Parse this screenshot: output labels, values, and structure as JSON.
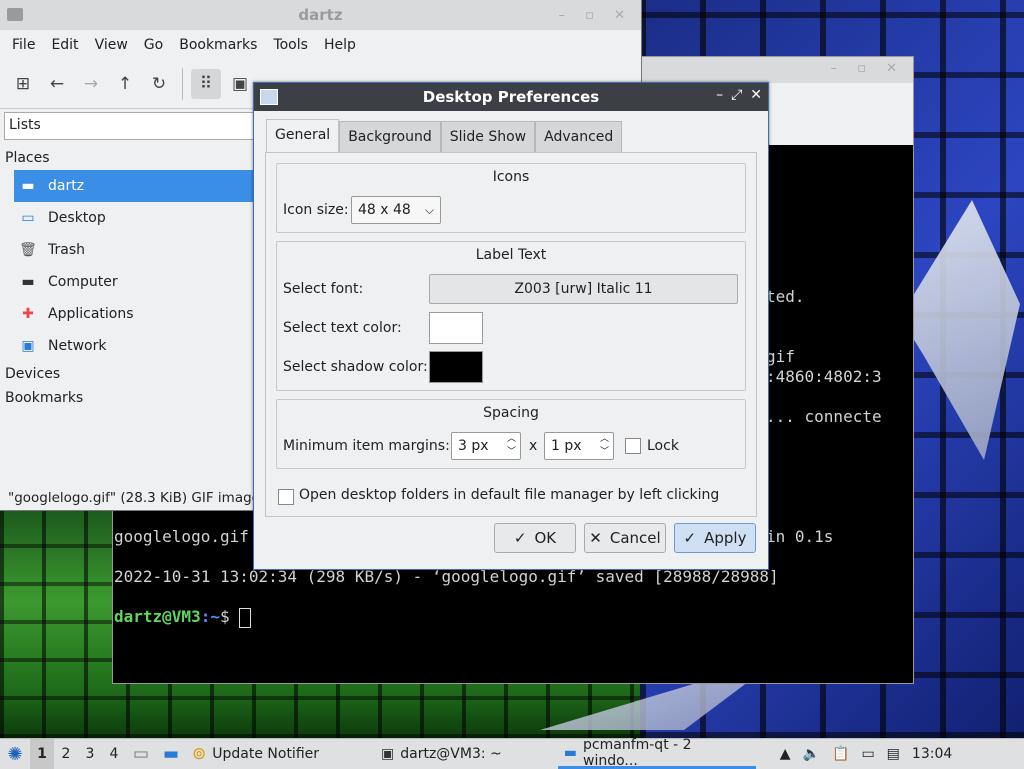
{
  "file_manager": {
    "title": "dartz",
    "menu": [
      "File",
      "Edit",
      "View",
      "Go",
      "Bookmarks",
      "Tools",
      "Help"
    ],
    "side_view": "Lists",
    "sections": {
      "places": "Places",
      "devices": "Devices",
      "bookmarks": "Bookmarks"
    },
    "places": [
      {
        "label": "dartz",
        "icon": "home-folder-icon"
      },
      {
        "label": "Desktop",
        "icon": "desktop-icon"
      },
      {
        "label": "Trash",
        "icon": "trash-icon"
      },
      {
        "label": "Computer",
        "icon": "computer-icon"
      },
      {
        "label": "Applications",
        "icon": "applications-icon"
      },
      {
        "label": "Network",
        "icon": "network-icon"
      }
    ],
    "status": "\"googlelogo.gif\" (28.3 KiB) GIF image"
  },
  "terminal": {
    "lines": [
      "ted.",
      "gif",
      ":4860:4802:3",
      "... connecte",
      "googlelogo.gif",
      "in 0.1s",
      "2022-10-31 13:02:34 (298 KB/s) - ‘googlelogo.gif’ saved [28988/28988]"
    ],
    "prompt_user": "dartz@VM3",
    "prompt_path": ":~",
    "prompt_symbol": "$"
  },
  "dialog": {
    "title": "Desktop Preferences",
    "tabs": [
      "General",
      "Background",
      "Slide Show",
      "Advanced"
    ],
    "active_tab": "General",
    "icons_group": "Icons",
    "icon_size_label": "Icon size:",
    "icon_size_value": "48 x 48",
    "label_group": "Label Text",
    "font_label": "Select font:",
    "font_value": "Z003 [urw] Italic 11",
    "text_color_label": "Select text color:",
    "text_color": "#ffffff",
    "shadow_color_label": "Select shadow color:",
    "shadow_color": "#000000",
    "spacing_group": "Spacing",
    "margins_label": "Minimum item margins:",
    "margin_x": "3 px",
    "times": "x",
    "margin_y": "1 px",
    "lock_label": "Lock",
    "open_folders_label": "Open desktop folders in default file manager by left clicking",
    "ok": "OK",
    "cancel": "Cancel",
    "apply": "Apply"
  },
  "taskbar": {
    "workspaces": [
      "1",
      "2",
      "3",
      "4"
    ],
    "tasks": [
      {
        "label": "Update Notifier",
        "icon": "update-notifier-icon"
      },
      {
        "label": "dartz@VM3: ~",
        "icon": "terminal-icon"
      },
      {
        "label": "pcmanfm-qt - 2 windo...",
        "icon": "folder-icon"
      }
    ],
    "clock": "13:04"
  }
}
